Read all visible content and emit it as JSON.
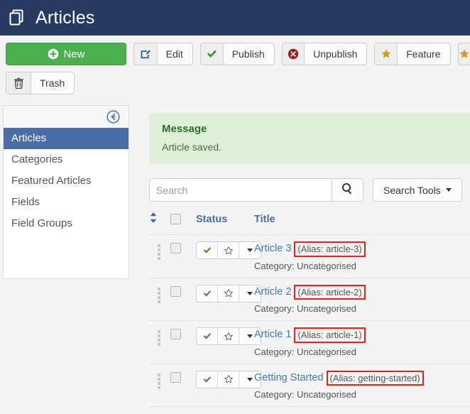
{
  "header": {
    "title": "Articles",
    "icon": "articles-stack-icon",
    "bg_color": "#273a61"
  },
  "toolbar": {
    "rows": [
      [
        {
          "name": "new-button",
          "label": "New",
          "icon": "plus-circle-icon",
          "style": "primary",
          "accent": "#4caf50"
        },
        {
          "name": "edit-button",
          "label": "Edit",
          "icon": "pencil-square-icon",
          "accent": "#2a6496"
        },
        {
          "name": "publish-button",
          "label": "Publish",
          "icon": "check-icon",
          "accent": "#3f8f29"
        },
        {
          "name": "unpublish-button",
          "label": "Unpublish",
          "icon": "times-circle-icon",
          "accent": "#9b2020"
        },
        {
          "name": "feature-button",
          "label": "Feature",
          "icon": "star-filled-icon",
          "accent": "#d39a21"
        },
        {
          "name": "unfeature-button",
          "label": "",
          "icon": "star-icon",
          "accent": "#d39a21",
          "clipped": true
        }
      ],
      [
        {
          "name": "trash-button",
          "label": "Trash",
          "icon": "trash-icon",
          "accent": "#4a4a4a"
        }
      ]
    ]
  },
  "sidebar": {
    "collapse_icon": "arrow-circle-left-icon",
    "items": [
      {
        "label": "Articles",
        "active": true
      },
      {
        "label": "Categories",
        "active": false
      },
      {
        "label": "Featured Articles",
        "active": false
      },
      {
        "label": "Fields",
        "active": false
      },
      {
        "label": "Field Groups",
        "active": false
      }
    ]
  },
  "message": {
    "heading": "Message",
    "text": "Article saved.",
    "bg_color": "#dff0d8",
    "fg_color": "#3c763d"
  },
  "search": {
    "placeholder": "Search",
    "value": "",
    "search_icon": "magnifier-icon",
    "tools_label": "Search Tools",
    "tools_icon": "chevron-down-icon"
  },
  "table": {
    "columns": {
      "sort": "ordering-sort-icon",
      "select_all": "select-all-checkbox",
      "status": "Status",
      "title": "Title"
    },
    "row_status_controls": {
      "publish_icon": "check-icon",
      "feature_icon": "star-outline-icon",
      "more_icon": "caret-down-icon"
    },
    "category_prefix": "Category:",
    "rows": [
      {
        "title": "Article 3",
        "alias": "(Alias: article-3)",
        "category": "Category: Uncategorised",
        "status": "published",
        "featured": false,
        "alias_highlighted": true
      },
      {
        "title": "Article 2",
        "alias": "(Alias: article-2)",
        "category": "Category: Uncategorised",
        "status": "published",
        "featured": false,
        "alias_highlighted": true
      },
      {
        "title": "Article 1",
        "alias": "(Alias: article-1)",
        "category": "Category: Uncategorised",
        "status": "published",
        "featured": false,
        "alias_highlighted": true
      },
      {
        "title": "Getting Started",
        "alias": "(Alias: getting-started)",
        "category": "Category: Uncategorised",
        "status": "published",
        "featured": false,
        "alias_highlighted": true
      }
    ]
  },
  "annotation": {
    "highlight_color": "#ee1c1c"
  }
}
